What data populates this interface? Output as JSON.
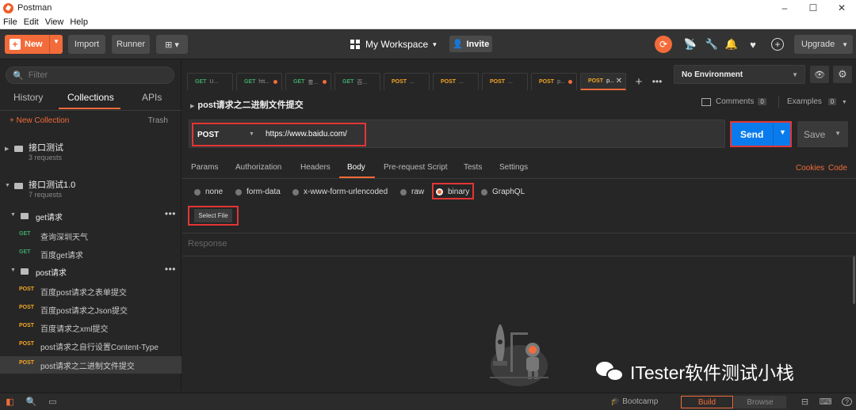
{
  "window": {
    "title": "Postman",
    "min": "–",
    "max": "☐",
    "close": "✕"
  },
  "menu": [
    "File",
    "Edit",
    "View",
    "Help"
  ],
  "header": {
    "new_label": "New",
    "import_label": "Import",
    "runner_label": "Runner",
    "workspace_label": "My Workspace",
    "workspace_caret": "▾",
    "invite_label": "Invite",
    "upgrade_label": "Upgrade"
  },
  "sidebar": {
    "filter_placeholder": "Filter",
    "tabs": [
      "History",
      "Collections",
      "APIs"
    ],
    "new_collection_label": "+ New Collection",
    "trash_label": "Trash",
    "collections": [
      {
        "name": "接口测试",
        "sub": "3 requests"
      },
      {
        "name": "接口测试1.0",
        "sub": "7 requests"
      }
    ],
    "folders": [
      {
        "name": "get请求",
        "more": "•••"
      },
      {
        "name": "post请求",
        "more": "•••"
      }
    ],
    "requests": [
      {
        "method": "GET",
        "name": "查询深圳天气"
      },
      {
        "method": "GET",
        "name": "百度get请求"
      },
      {
        "method": "POST",
        "name": "百度post请求之表单提交"
      },
      {
        "method": "POST",
        "name": "百度post请求之Json提交"
      },
      {
        "method": "POST",
        "name": "百度请求之xml提交"
      },
      {
        "method": "POST",
        "name": "post请求之自行设置Content-Type"
      },
      {
        "method": "POST",
        "name": "post请求之二进制文件提交"
      }
    ]
  },
  "tabs": [
    {
      "method": "GET",
      "name": "U..."
    },
    {
      "method": "GET",
      "name": "htt..."
    },
    {
      "method": "GET",
      "name": "查..."
    },
    {
      "method": "GET",
      "name": "百..."
    },
    {
      "method": "POST",
      "name": "..."
    },
    {
      "method": "POST",
      "name": "..."
    },
    {
      "method": "POST",
      "name": "..."
    },
    {
      "method": "POST",
      "name": "p..."
    },
    {
      "method": "POST",
      "name": "p..."
    }
  ],
  "tab_add": "+",
  "tab_more": "•••",
  "environment": {
    "selected": "No Environment"
  },
  "request": {
    "title": "post请求之二进制文件提交",
    "comments_label": "Comments",
    "comments_count": "0",
    "examples_label": "Examples",
    "examples_count": "0",
    "method": "POST",
    "url": "https://www.baidu.com/",
    "send_label": "Send",
    "save_label": "Save",
    "subtabs": [
      "Params",
      "Authorization",
      "Headers",
      "Body",
      "Pre-request Script",
      "Tests",
      "Settings"
    ],
    "active_subtab": "Body",
    "cookies_label": "Cookies",
    "code_label": "Code",
    "body_types": [
      "none",
      "form-data",
      "x-www-form-urlencoded",
      "raw",
      "binary",
      "GraphQL"
    ],
    "selected_body_type": "binary",
    "select_file_label": "Select File"
  },
  "response": {
    "label": "Response"
  },
  "watermark": {
    "text": "ITester软件测试小栈"
  },
  "footer": {
    "bootcamp_label": "Bootcamp",
    "build_label": "Build",
    "browse_label": "Browse"
  },
  "colors": {
    "accent": "#f26b3a",
    "send_blue": "#097bed",
    "highlight_red": "#e33535",
    "get_green": "#3ea86b",
    "post_orange": "#f5a623"
  }
}
